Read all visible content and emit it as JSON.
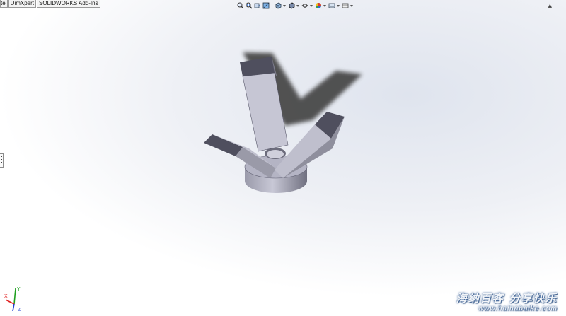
{
  "command_manager": {
    "tabs": [
      {
        "label": "te"
      },
      {
        "label": "DimXpert"
      },
      {
        "label": "SOLIDWORKS Add-Ins"
      }
    ]
  },
  "heads_up_toolbar": {
    "icons": [
      "zoom-to-fit-icon",
      "zoom-to-area-icon",
      "previous-view-icon",
      "section-view-icon",
      "view-orientation-icon",
      "display-style-icon",
      "hide-show-items-icon",
      "edit-appearance-icon",
      "apply-scene-icon",
      "view-settings-icon"
    ]
  },
  "triad": {
    "axes": {
      "y": "Y",
      "x": "X",
      "z": "Z"
    },
    "colors": {
      "x": "#e02020",
      "y": "#20a020",
      "z": "#2040d0"
    }
  },
  "watermark": {
    "text": "海纳百客 分享快乐",
    "url": "www.hainabaike.com"
  },
  "colors": {
    "face_light": "#c3c3d1",
    "face_mid": "#8d8d9b",
    "face_dark": "#4f4f5e",
    "shadow": "#4a4a4a"
  }
}
